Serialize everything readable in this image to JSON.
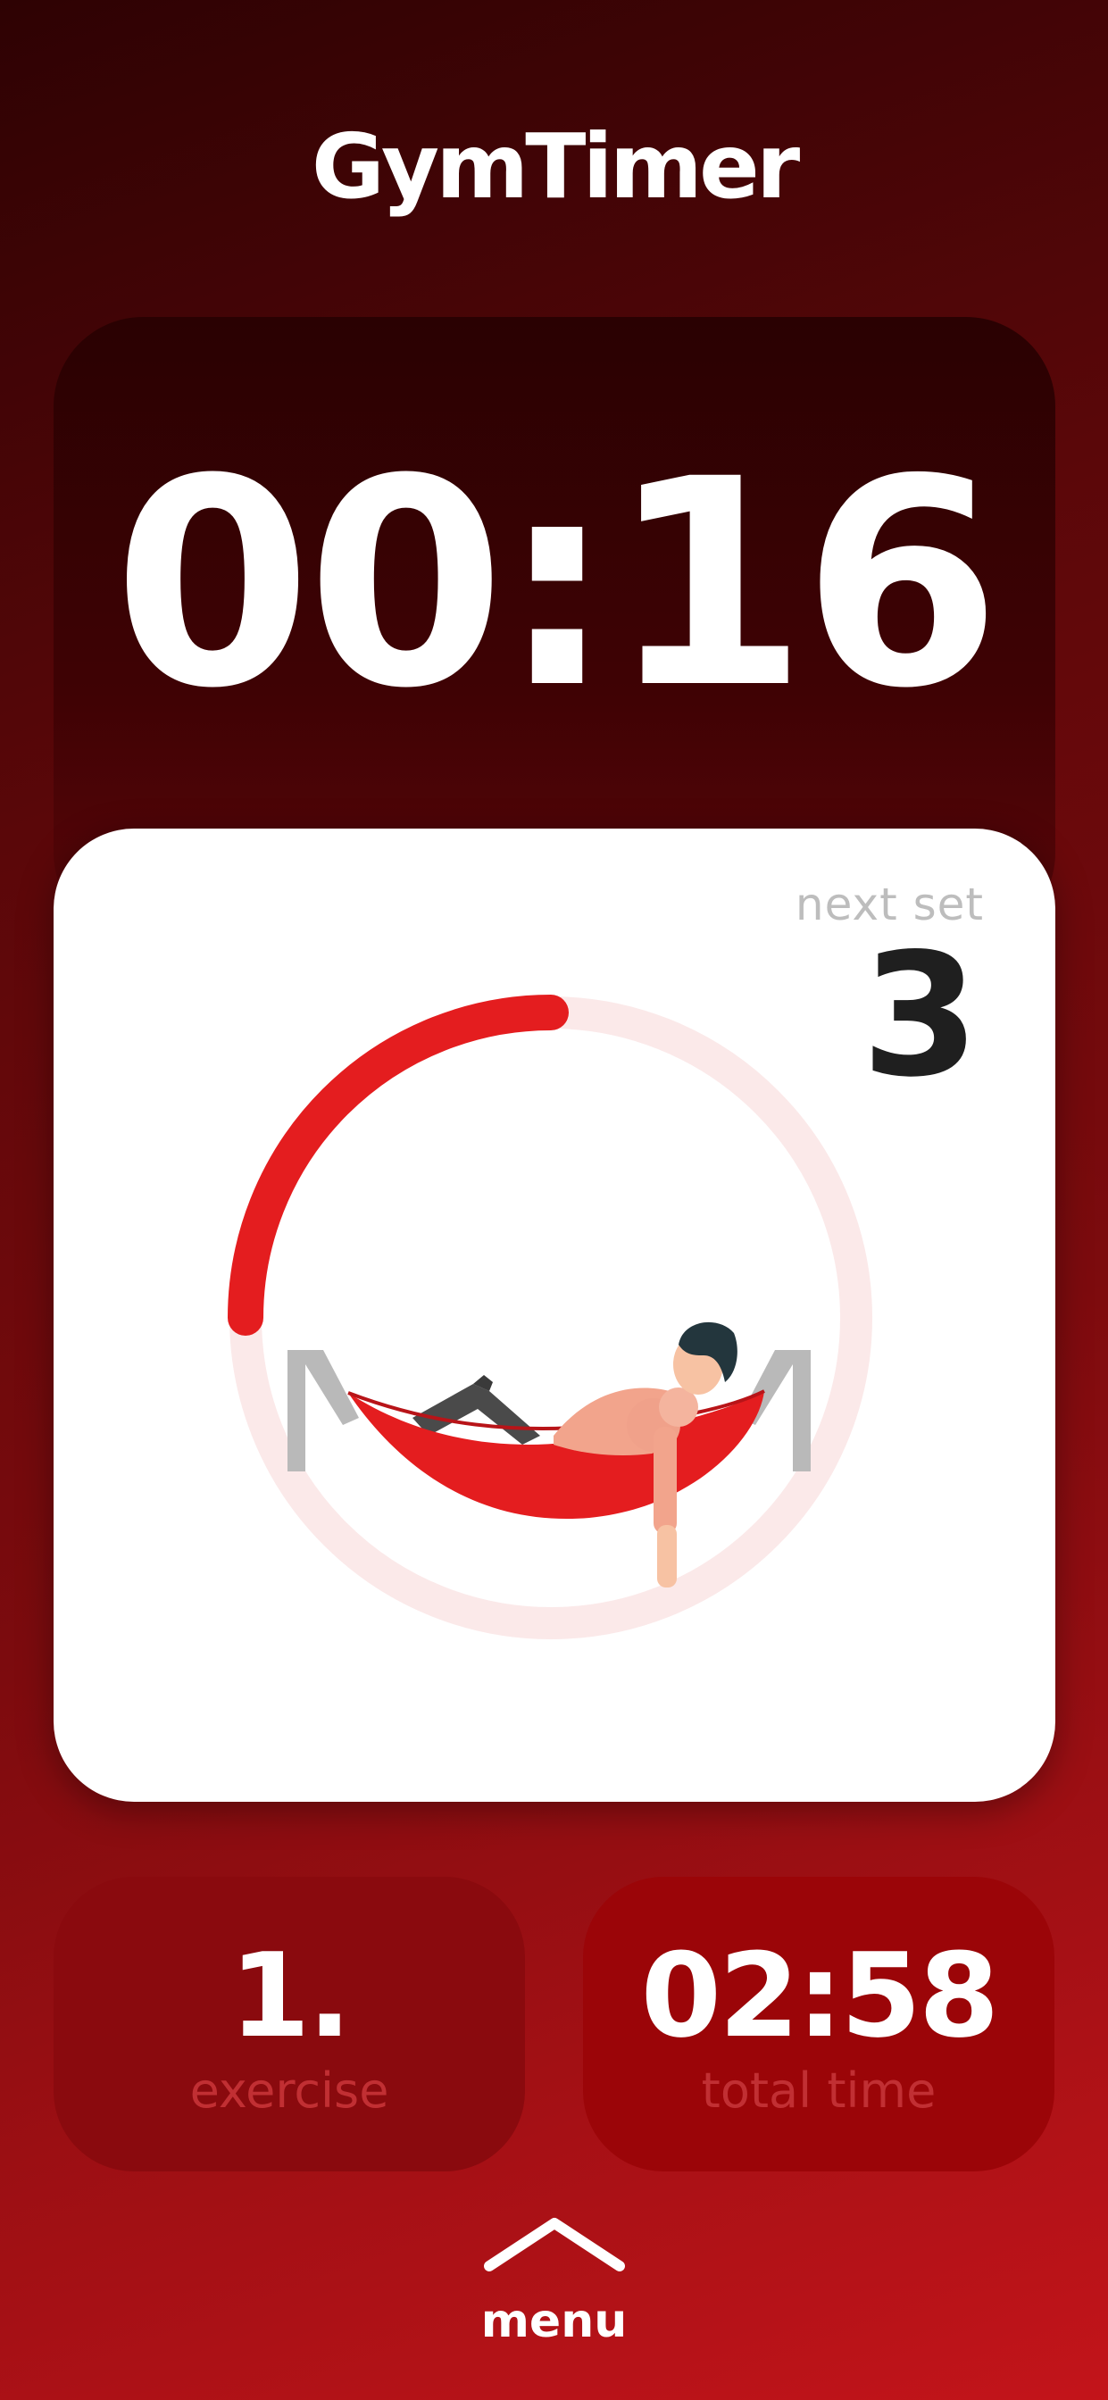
{
  "header": {
    "title": "GymTimer"
  },
  "timer": {
    "display": "00:16"
  },
  "rest_card": {
    "next_set_label": "next set",
    "next_set_value": "3",
    "progress_fraction": 0.25,
    "illustration": "man-resting-in-hammock"
  },
  "stats": {
    "exercise": {
      "value": "1.",
      "label": "exercise"
    },
    "total_time": {
      "value": "02:58",
      "label": "total time"
    }
  },
  "menu": {
    "label": "menu",
    "icon": "chevron-up-icon"
  },
  "colors": {
    "accent": "#e41d1f",
    "ring_track": "#fbe9e9",
    "background_top": "#2e0203",
    "background_bottom": "#c3141a"
  }
}
